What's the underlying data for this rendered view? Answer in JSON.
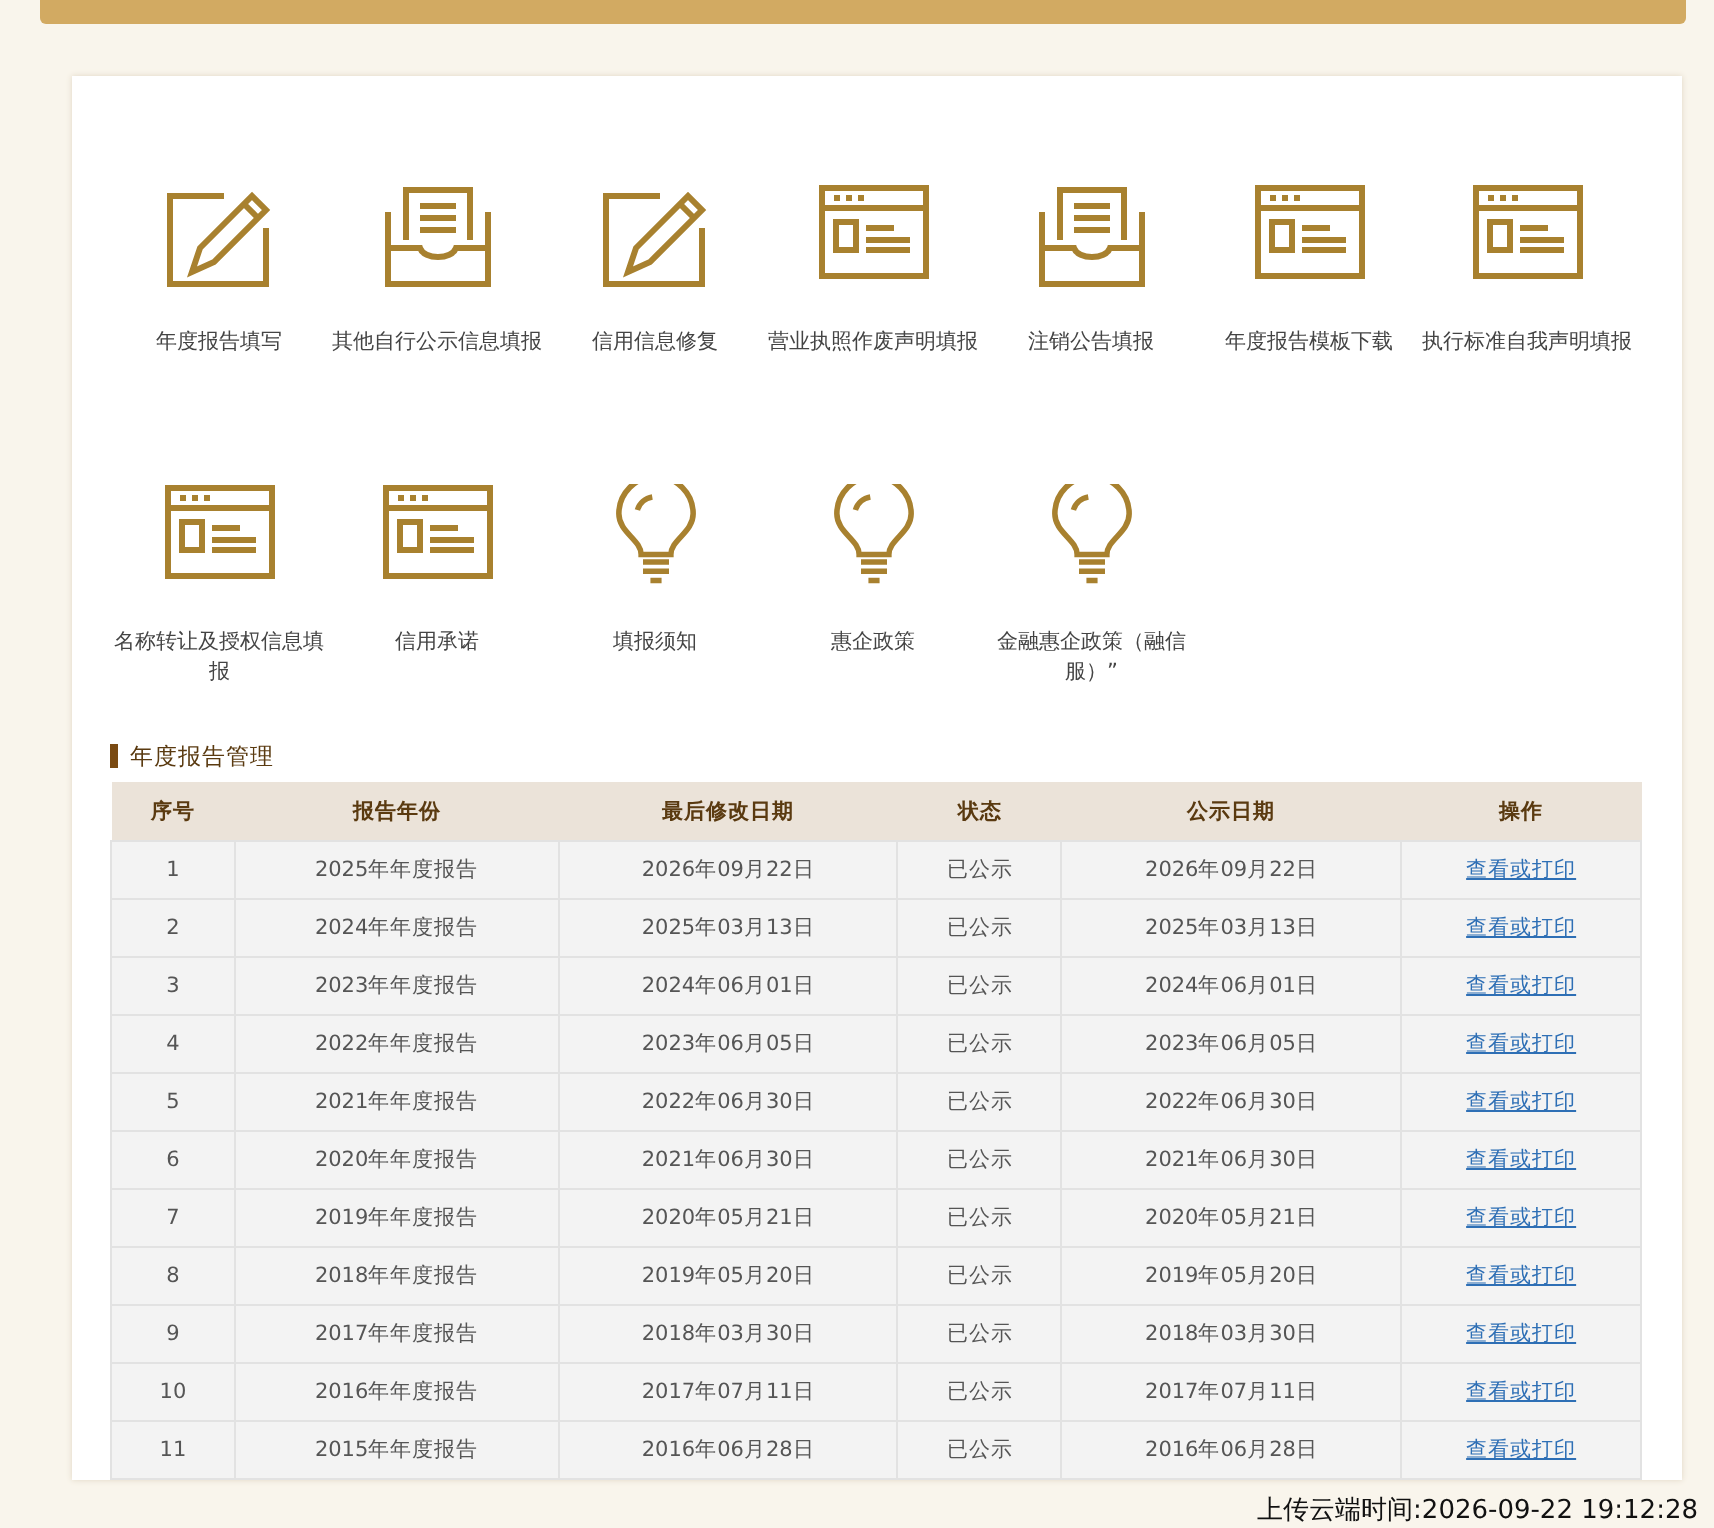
{
  "shortcuts": [
    {
      "label": "年度报告填写",
      "kind": "pencil"
    },
    {
      "label": "其他自行公示信息填报",
      "kind": "tray"
    },
    {
      "label": "信用信息修复",
      "kind": "pencil"
    },
    {
      "label": "营业执照作废声明填报",
      "kind": "form"
    },
    {
      "label": "注销公告填报",
      "kind": "tray"
    },
    {
      "label": "年度报告模板下载",
      "kind": "form"
    },
    {
      "label": "执行标准自我声明填报",
      "kind": "form"
    },
    {
      "label": "名称转让及授权信息填报",
      "kind": "form"
    },
    {
      "label": "信用承诺",
      "kind": "form"
    },
    {
      "label": "填报须知",
      "kind": "bulb"
    },
    {
      "label": "惠企政策",
      "kind": "bulb"
    },
    {
      "label": "金融惠企政策（融信服）”",
      "kind": "bulb"
    }
  ],
  "section_title": "年度报告管理",
  "table": {
    "columns": [
      "序号",
      "报告年份",
      "最后修改日期",
      "状态",
      "公示日期",
      "操作"
    ],
    "rows": [
      [
        "1",
        "2025年年度报告",
        "2026年09月22日",
        "已公示",
        "2026年09月22日",
        "查看或打印"
      ],
      [
        "2",
        "2024年年度报告",
        "2025年03月13日",
        "已公示",
        "2025年03月13日",
        "查看或打印"
      ],
      [
        "3",
        "2023年年度报告",
        "2024年06月01日",
        "已公示",
        "2024年06月01日",
        "查看或打印"
      ],
      [
        "4",
        "2022年年度报告",
        "2023年06月05日",
        "已公示",
        "2023年06月05日",
        "查看或打印"
      ],
      [
        "5",
        "2021年年度报告",
        "2022年06月30日",
        "已公示",
        "2022年06月30日",
        "查看或打印"
      ],
      [
        "6",
        "2020年年度报告",
        "2021年06月30日",
        "已公示",
        "2021年06月30日",
        "查看或打印"
      ],
      [
        "7",
        "2019年年度报告",
        "2020年05月21日",
        "已公示",
        "2020年05月21日",
        "查看或打印"
      ],
      [
        "8",
        "2018年年度报告",
        "2019年05月20日",
        "已公示",
        "2019年05月20日",
        "查看或打印"
      ],
      [
        "9",
        "2017年年度报告",
        "2018年03月30日",
        "已公示",
        "2018年03月30日",
        "查看或打印"
      ],
      [
        "10",
        "2016年年度报告",
        "2017年07月11日",
        "已公示",
        "2017年07月11日",
        "查看或打印"
      ],
      [
        "11",
        "2015年年度报告",
        "2016年06月28日",
        "已公示",
        "2016年06月28日",
        "查看或打印"
      ]
    ]
  },
  "upload_time": "上传云端时间:2026-09-22 19:12:28"
}
